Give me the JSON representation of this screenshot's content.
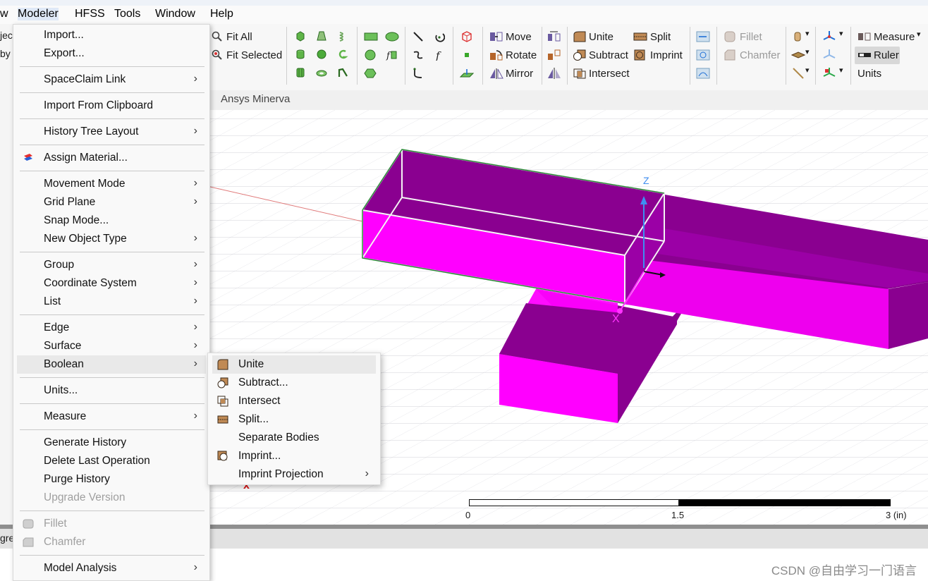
{
  "menubar": {
    "items": [
      "w",
      "Modeler",
      "HFSS",
      "Tools",
      "Window",
      "Help"
    ]
  },
  "ribbon": {
    "fit_all": "Fit All",
    "fit_selected": "Fit Selected",
    "move": "Move",
    "rotate": "Rotate",
    "mirror": "Mirror",
    "unite": "Unite",
    "subtract": "Subtract",
    "intersect": "Intersect",
    "split": "Split",
    "imprint": "Imprint",
    "fillet": "Fillet",
    "chamfer": "Chamfer",
    "measure": "Measure",
    "ruler": "Ruler",
    "units": "Units",
    "tab_minerva": "Ansys Minerva"
  },
  "left_panel": {
    "frag1": "jec",
    "frag2": "by",
    "frag3": "gre"
  },
  "modeler_menu": {
    "import": "Import...",
    "export": "Export...",
    "spaceclaim_link": "SpaceClaim Link",
    "import_clipboard": "Import From Clipboard",
    "history_tree_layout": "History Tree Layout",
    "assign_material": "Assign Material...",
    "movement_mode": "Movement Mode",
    "grid_plane": "Grid Plane",
    "snap_mode": "Snap Mode...",
    "new_object_type": "New Object Type",
    "group": "Group",
    "coordinate_system": "Coordinate System",
    "list": "List",
    "edge": "Edge",
    "surface": "Surface",
    "boolean": "Boolean",
    "units": "Units...",
    "measure": "Measure",
    "generate_history": "Generate History",
    "delete_last_operation": "Delete Last Operation",
    "purge_history": "Purge History",
    "upgrade_version": "Upgrade Version",
    "fillet": "Fillet",
    "chamfer": "Chamfer",
    "model_analysis": "Model Analysis",
    "submenu_arrow": "›"
  },
  "boolean_submenu": {
    "unite": "Unite",
    "subtract": "Subtract...",
    "intersect": "Intersect",
    "split": "Split...",
    "separate_bodies": "Separate Bodies",
    "imprint": "Imprint...",
    "imprint_projection": "Imprint Projection"
  },
  "viewport": {
    "axis_z": "Z",
    "axis_x": "X",
    "small_x": "x",
    "scale_0": "0",
    "scale_mid": "1.5",
    "scale_end": "3 (in)"
  },
  "watermark": "CSDN @自由学习一门语言",
  "colors": {
    "body_magenta": "#ff00ff",
    "body_dark": "#8a0090",
    "accent_selected_edge": "#2e8b3a",
    "axis_blue": "#3f8ef0"
  }
}
